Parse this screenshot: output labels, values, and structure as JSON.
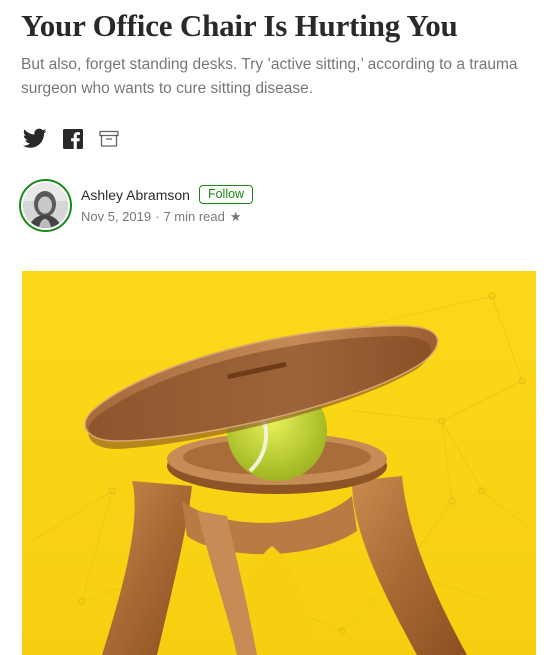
{
  "article": {
    "title": "Your Office Chair Is Hurting You",
    "subtitle": "But also, forget standing desks. Try ’active sitting,’ according to a trauma surgeon who wants to cure sitting disease."
  },
  "share": {
    "icons": [
      "twitter-icon",
      "facebook-icon",
      "bookmark-icon"
    ]
  },
  "author": {
    "name": "Ashley Abramson",
    "follow_label": "Follow",
    "date": "Nov 5, 2019",
    "separator": "·",
    "read_time": "7 min read",
    "star": "★"
  },
  "colors": {
    "accent_green": "#1a8917",
    "hero_yellow": "#f9d71c",
    "text_dark": "rgba(0,0,0,0.84)",
    "text_muted": "rgba(0,0,0,0.54)"
  },
  "hero_image": {
    "subject": "wooden balance stool with tennis ball on yellow background"
  }
}
